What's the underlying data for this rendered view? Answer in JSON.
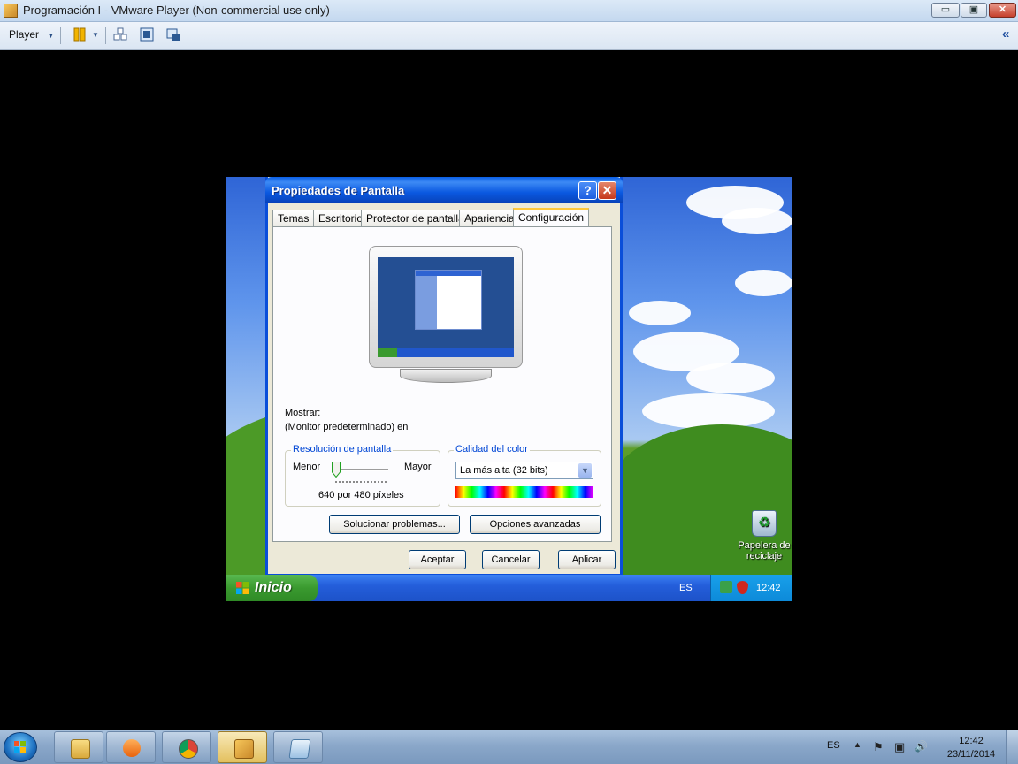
{
  "vmware": {
    "title": "Programación I - VMware Player (Non-commercial use only)",
    "window_buttons": {
      "minimize": "▭",
      "maximize": "▣",
      "close": "✕"
    },
    "toolbar": {
      "player_label": "Player",
      "icons": [
        "pause-icon",
        "send-keys-icon",
        "fullscreen-icon",
        "unity-icon"
      ],
      "collapse_glyph": "«"
    }
  },
  "guest": {
    "dialog": {
      "title": "Propiedades de Pantalla",
      "help_glyph": "?",
      "close_glyph": "✕",
      "tabs": [
        "Temas",
        "Escritorio",
        "Protector de pantalla",
        "Apariencia",
        "Configuración"
      ],
      "active_tab": "Configuración",
      "display_label": "Mostrar:",
      "display_value": "(Monitor predeterminado) en",
      "resolution": {
        "group_label": "Resolución de pantalla",
        "min_label": "Menor",
        "max_label": "Mayor",
        "value_text": "640 por 480 píxeles",
        "slider_level": 0.0
      },
      "color_quality": {
        "group_label": "Calidad del color",
        "selected": "La más alta (32 bits)"
      },
      "buttons": {
        "troubleshoot": "Solucionar problemas...",
        "advanced": "Opciones avanzadas",
        "ok": "Aceptar",
        "cancel": "Cancelar",
        "apply": "Aplicar"
      }
    },
    "desktop": {
      "recycle_bin_label": "Papelera de reciclaje"
    },
    "taskbar": {
      "start_label": "Inicio",
      "language": "ES",
      "clock": "12:42"
    }
  },
  "host_taskbar": {
    "pinned": [
      "explorer-icon",
      "media-player-icon",
      "chrome-icon",
      "vmware-icon",
      "notepad-icon"
    ],
    "language": "ES",
    "tray_glyphs": {
      "show_hidden": "▲",
      "action_center": "⚑",
      "network": "▣",
      "volume": "🔊"
    },
    "time": "12:42",
    "date": "23/11/2014"
  },
  "colors": {
    "xp_blue": "#0a4ed9",
    "xp_start_green": "#3a9a2f",
    "dialog_face": "#ece9d8",
    "tab_highlight": "#ffc83c",
    "group_label_blue": "#0046d5"
  }
}
